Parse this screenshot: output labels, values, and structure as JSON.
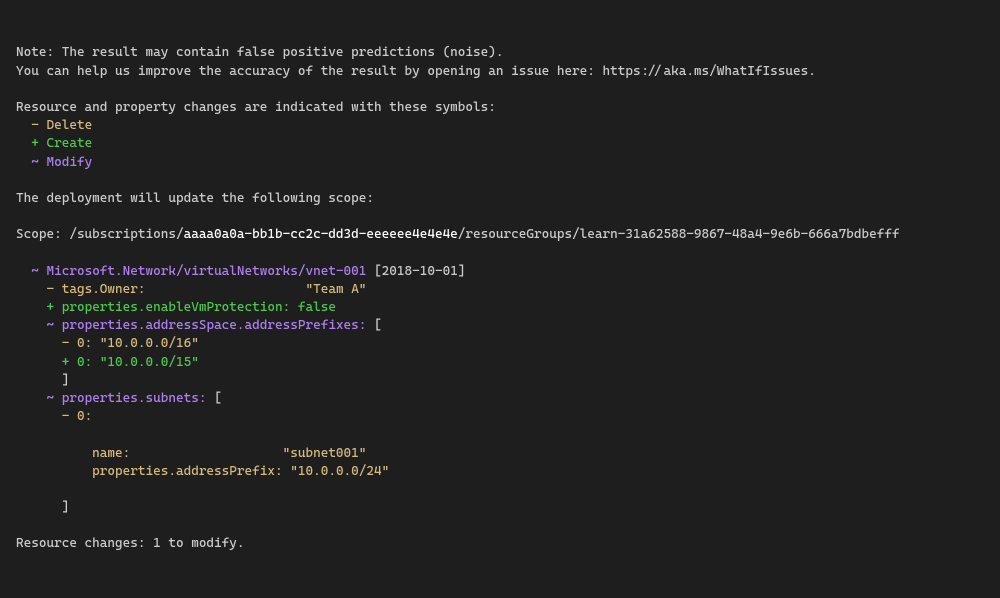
{
  "note": "Note: The result may contain false positive predictions (noise).",
  "helpText": "You can help us improve the accuracy of the result by opening an issue here: https://aka.ms/WhatIfIssues.",
  "changesHeader": "Resource and property changes are indicated with these symbols:",
  "symbols": {
    "delete": {
      "sym": "-",
      "label": "Delete"
    },
    "create": {
      "sym": "+",
      "label": "Create"
    },
    "modify": {
      "sym": "~",
      "label": "Modify"
    }
  },
  "deploymentText": "The deployment will update the following scope:",
  "scopePrefix": "Scope: /subscriptions/",
  "subscriptionId": "aaaa0a0a-bb1b-cc2c-dd3d-eeeeee4e4e4e",
  "scopeSuffix": "/resourceGroups/learn-31a62588-9867-48a4-9e6b-666a7bdbefff",
  "resource": {
    "sym": "~",
    "path": "Microsoft.Network/virtualNetworks/vnet-001",
    "version": "[2018-10-01]"
  },
  "props": {
    "tagsOwner": {
      "sym": "-",
      "key": "tags.Owner:",
      "value": "\"Team A\""
    },
    "enableVm": {
      "sym": "+",
      "key": "properties.enableVmProtection:",
      "value": "false"
    },
    "addrPrefixes": {
      "sym": "~",
      "key": "properties.addressSpace.addressPrefixes:",
      "bracket": "["
    },
    "addrOld": {
      "sym": "-",
      "idx": "0:",
      "value": "\"10.0.0.0/16\""
    },
    "addrNew": {
      "sym": "+",
      "idx": "0:",
      "value": "\"10.0.0.0/15\""
    },
    "closeBracket1": "]",
    "subnets": {
      "sym": "~",
      "key": "properties.subnets:",
      "bracket": "["
    },
    "subnetIdx": {
      "sym": "-",
      "idx": "0:"
    },
    "subnetName": {
      "key": "name:",
      "value": "\"subnet001\""
    },
    "subnetAddr": {
      "key": "properties.addressPrefix:",
      "value": "\"10.0.0.0/24\""
    },
    "closeBracket2": "]"
  },
  "summary": "Resource changes: 1 to modify."
}
